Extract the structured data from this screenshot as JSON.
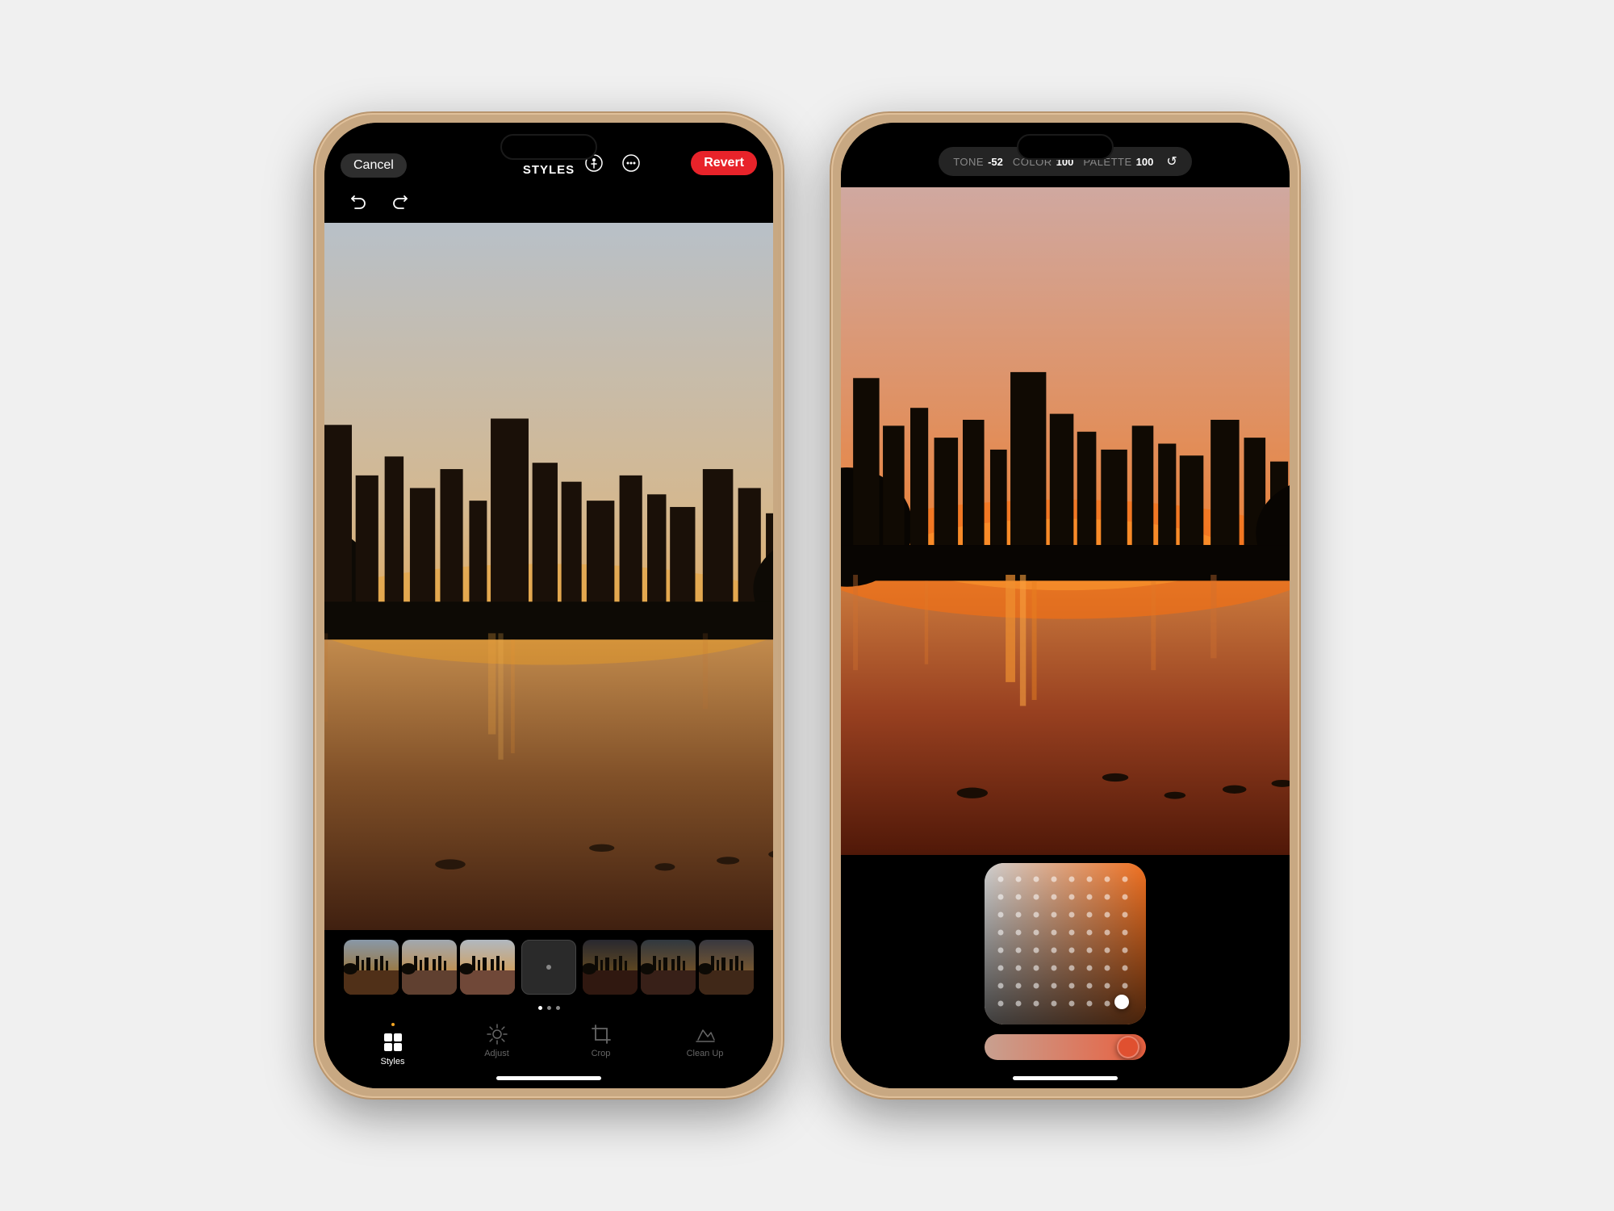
{
  "phone_left": {
    "top_bar": {
      "cancel_label": "Cancel",
      "revert_label": "Revert",
      "styles_label": "STYLES"
    },
    "tabs": [
      {
        "id": "styles",
        "label": "Styles",
        "icon": "grid",
        "active": true
      },
      {
        "id": "adjust",
        "label": "Adjust",
        "icon": "sun",
        "active": false
      },
      {
        "id": "crop",
        "label": "Crop",
        "icon": "crop",
        "active": false
      },
      {
        "id": "cleanup",
        "label": "Clean Up",
        "icon": "eraser",
        "active": false
      }
    ],
    "home_indicator": true
  },
  "phone_right": {
    "top_bar": {
      "tone_label": "TONE",
      "tone_value": "-52",
      "color_label": "COLOR",
      "color_value": "100",
      "palette_label": "PALETTE",
      "palette_value": "100"
    },
    "home_indicator": true
  }
}
